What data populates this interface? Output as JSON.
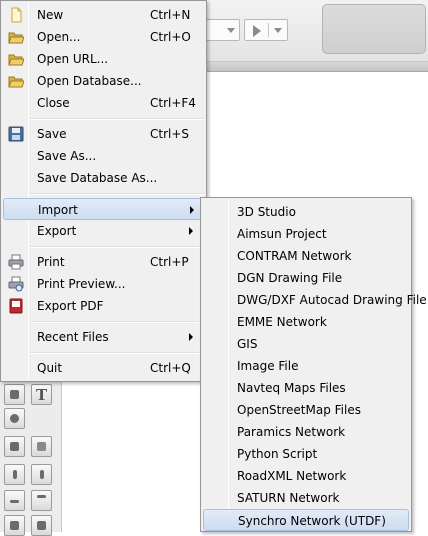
{
  "file_menu": {
    "items": [
      {
        "label": "New",
        "shortcut": "Ctrl+N",
        "icon": "new-file-icon"
      },
      {
        "label": "Open...",
        "shortcut": "Ctrl+O",
        "icon": "open-folder-icon"
      },
      {
        "label": "Open URL...",
        "shortcut": "",
        "icon": "open-folder-icon"
      },
      {
        "label": "Open Database...",
        "shortcut": "",
        "icon": "open-folder-icon"
      },
      {
        "label": "Close",
        "shortcut": "Ctrl+F4",
        "icon": ""
      },
      {
        "label": "Save",
        "shortcut": "Ctrl+S",
        "icon": "floppy-disk-icon"
      },
      {
        "label": "Save As...",
        "shortcut": "",
        "icon": ""
      },
      {
        "label": "Save Database As...",
        "shortcut": "",
        "icon": ""
      },
      {
        "label": "Import",
        "shortcut": "",
        "icon": "",
        "submenu": true
      },
      {
        "label": "Export",
        "shortcut": "",
        "icon": "",
        "submenu": true
      },
      {
        "label": "Print",
        "shortcut": "Ctrl+P",
        "icon": "printer-icon"
      },
      {
        "label": "Print Preview...",
        "shortcut": "",
        "icon": "print-preview-icon"
      },
      {
        "label": "Export PDF",
        "shortcut": "",
        "icon": "pdf-icon"
      },
      {
        "label": "Recent Files",
        "shortcut": "",
        "icon": "",
        "submenu": true
      },
      {
        "label": "Quit",
        "shortcut": "Ctrl+Q",
        "icon": ""
      }
    ],
    "highlighted": "Import"
  },
  "import_submenu": {
    "items": [
      "3D Studio",
      "Aimsun Project",
      "CONTRAM Network",
      "DGN Drawing File",
      "DWG/DXF Autocad Drawing File",
      "EMME Network",
      "GIS",
      "Image File",
      "Navteq Maps Files",
      "OpenStreetMap Files",
      "Paramics Network",
      "Python Script",
      "RoadXML Network",
      "SATURN Network",
      "Synchro Network (UTDF)"
    ],
    "highlighted": "Synchro Network (UTDF)"
  },
  "colors": {
    "menu_bg": "#f0f0f0",
    "highlight_bg": "#cddcf0",
    "highlight_border": "#a8c0e0",
    "menu_border": "#979797"
  }
}
